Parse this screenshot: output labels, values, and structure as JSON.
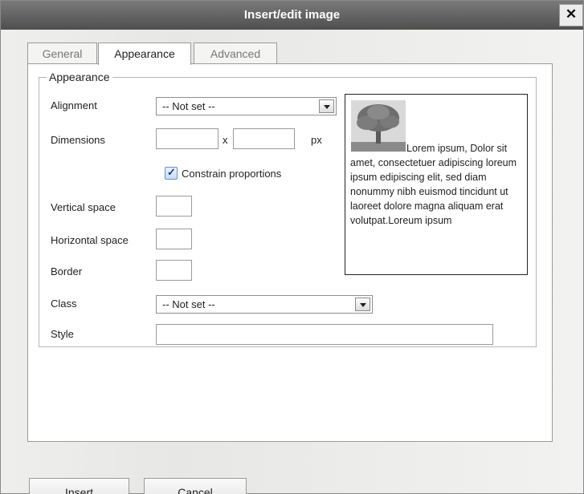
{
  "dialog": {
    "title": "Insert/edit image",
    "close_glyph": "✕"
  },
  "tabs": [
    {
      "label": "General",
      "active": false
    },
    {
      "label": "Appearance",
      "active": true
    },
    {
      "label": "Advanced",
      "active": false
    }
  ],
  "appearance": {
    "legend": "Appearance",
    "alignment_label": "Alignment",
    "alignment_value": "-- Not set --",
    "dimensions_label": "Dimensions",
    "dimensions_sep": "x",
    "dimensions_unit": "px",
    "width_value": "",
    "height_value": "",
    "constrain_label": "Constrain proportions",
    "constrain_checked": true,
    "vspace_label": "Vertical space",
    "vspace_value": "",
    "hspace_label": "Horizontal space",
    "hspace_value": "",
    "border_label": "Border",
    "border_value": "",
    "class_label": "Class",
    "class_value": "-- Not set --",
    "style_label": "Style",
    "style_value": "",
    "preview_text": "Lorem ipsum, Dolor sit amet, consectetuer adipiscing loreum ipsum edipiscing elit, sed diam nonummy nibh euismod tincidunt ut laoreet dolore magna aliquam erat volutpat.Loreum ipsum"
  },
  "footer": {
    "insert_label": "Insert",
    "cancel_label": "Cancel"
  },
  "icons": {
    "close": "close-icon",
    "preview_image": "tree-image-icon",
    "dropdown": "chevron-down-icon"
  }
}
